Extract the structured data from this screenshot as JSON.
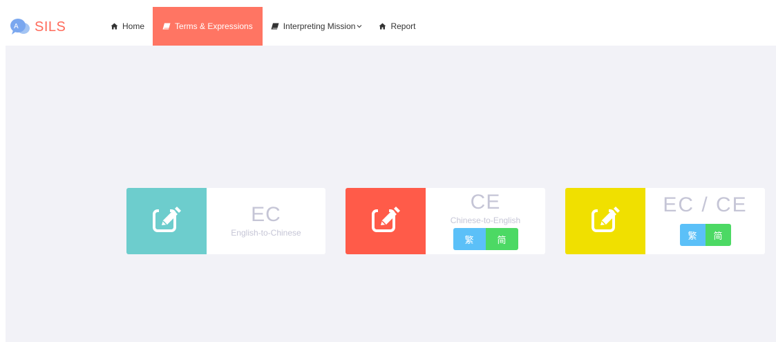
{
  "brand": {
    "name": "SILS",
    "logo_icon": "chat-bubble-logo-icon",
    "color": "#ff6a5a"
  },
  "nav": {
    "items": [
      {
        "label": "Home",
        "icon": "home-icon",
        "active": false
      },
      {
        "label": "Terms & Expressions",
        "icon": "book-icon",
        "active": true
      },
      {
        "label": "Interpreting Mission",
        "icon": "book-icon",
        "active": false,
        "dropdown": true
      },
      {
        "label": "Report",
        "icon": "home-icon",
        "active": false
      }
    ],
    "active_color": "#ff7563"
  },
  "cards": [
    {
      "title": "EC",
      "subtitle": "English-to-Chinese",
      "icon": "edit-icon",
      "color": "#6dcdcd",
      "buttons": []
    },
    {
      "title": "CE",
      "subtitle": "Chinese-to-English",
      "icon": "edit-icon",
      "color": "#ff5b49",
      "buttons": [
        "繁",
        "简"
      ]
    },
    {
      "title": "EC / CE",
      "subtitle": "",
      "icon": "edit-icon",
      "color": "#f0e000",
      "buttons": [
        "繁",
        "简"
      ]
    }
  ],
  "colors": {
    "background": "#f2f2f7",
    "traditional_button": "#5bc0f8",
    "simplified_button": "#4cd964",
    "title_text": "#c5c5d6"
  }
}
